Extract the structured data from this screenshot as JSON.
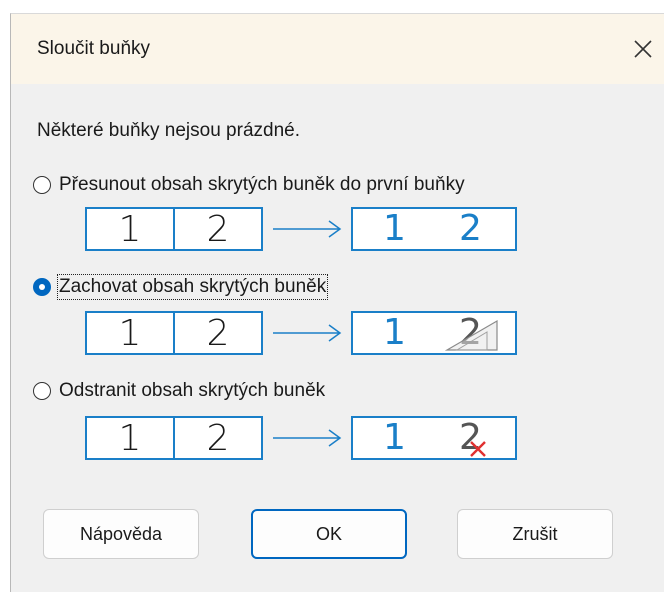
{
  "dialog": {
    "title": "Sloučit buňky",
    "message": "Některé buňky nejsou prázdné."
  },
  "options": [
    {
      "label": "Přesunout obsah skrytých buněk do první buňky",
      "selected": false,
      "demo": {
        "left": "1",
        "right": "2",
        "result_a": "1",
        "result_b": "2",
        "result_b_style": "blue"
      }
    },
    {
      "label": "Zachovat obsah skrytých buněk",
      "selected": true,
      "demo": {
        "left": "1",
        "right": "2",
        "result_a": "1",
        "result_b": "2",
        "result_b_style": "hidden-triangle"
      }
    },
    {
      "label": "Odstranit obsah skrytých buněk",
      "selected": false,
      "demo": {
        "left": "1",
        "right": "2",
        "result_a": "1",
        "result_b": "2",
        "result_b_style": "deleted-x"
      }
    }
  ],
  "buttons": {
    "help": "Nápověda",
    "ok": "OK",
    "cancel": "Zrušit"
  },
  "icons": {
    "close": "close-icon",
    "arrow": "arrow-right-icon",
    "delete": "red-x-icon",
    "hidden": "triangle-icon"
  },
  "colors": {
    "accent": "#0067c0",
    "cell_border": "#1a7fc8",
    "delete_mark": "#e03030",
    "titlebar": "#fbf5e9"
  }
}
